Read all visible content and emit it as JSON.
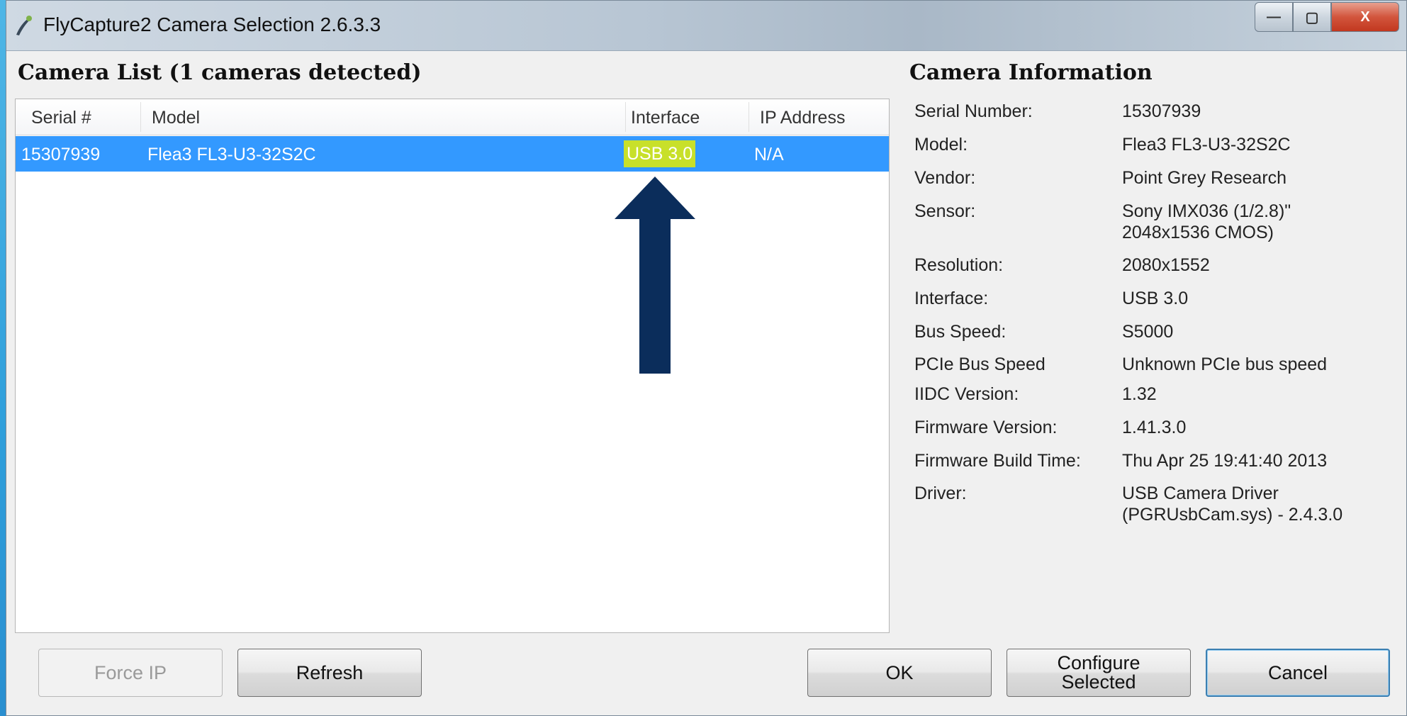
{
  "window": {
    "title": "FlyCapture2 Camera Selection 2.6.3.3",
    "controls": {
      "minimize": "—",
      "maximize": "▢",
      "close": "X"
    }
  },
  "camera_list": {
    "title": "Camera List (1 cameras detected)",
    "columns": [
      "Serial #",
      "Model",
      "Interface",
      "IP Address"
    ],
    "rows": [
      {
        "serial": "15307939",
        "model": "Flea3 FL3-U3-32S2C",
        "interface": "USB 3.0",
        "ip": "N/A"
      }
    ]
  },
  "camera_info": {
    "title": "Camera Information",
    "fields": [
      {
        "label": "Serial Number:",
        "value": "15307939"
      },
      {
        "label": "Model:",
        "value": "Flea3 FL3-U3-32S2C"
      },
      {
        "label": "Vendor:",
        "value": "Point Grey Research"
      },
      {
        "label": "Sensor:",
        "value": "Sony IMX036 (1/2.8)\"",
        "value2": "2048x1536 CMOS)"
      },
      {
        "label": "Resolution:",
        "value": "2080x1552"
      },
      {
        "label": "Interface:",
        "value": "USB 3.0"
      },
      {
        "label": "Bus Speed:",
        "value": "S5000"
      },
      {
        "label": "PCIe Bus Speed",
        "value": "Unknown PCIe bus speed"
      },
      {
        "label": "IIDC Version:",
        "value": "1.32"
      },
      {
        "label": "Firmware Version:",
        "value": "1.41.3.0"
      },
      {
        "label": "Firmware Build Time:",
        "value": "Thu Apr 25 19:41:40 2013"
      },
      {
        "label": "Driver:",
        "value": "USB Camera Driver",
        "value2": "(PGRUsbCam.sys) - 2.4.3.0"
      }
    ]
  },
  "buttons": {
    "force_ip": "Force IP",
    "refresh": "Refresh",
    "ok": "OK",
    "configure_line1": "Configure",
    "configure_line2": "Selected",
    "cancel": "Cancel"
  },
  "colors": {
    "selection": "#3399ff",
    "highlight": "#c8e02a",
    "annotation_arrow": "#0b2d5b"
  }
}
